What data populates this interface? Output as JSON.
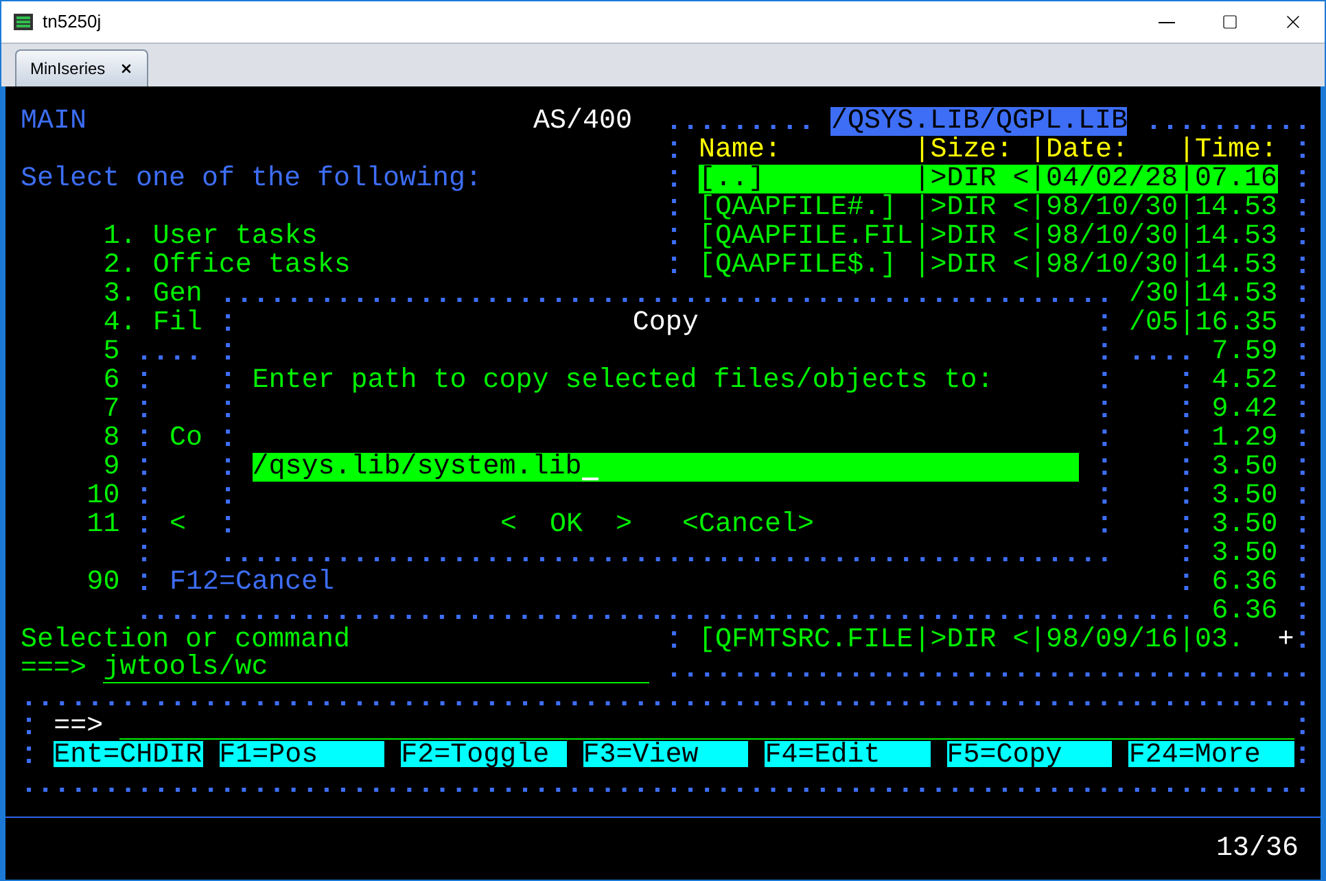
{
  "window": {
    "title": "tn5250j"
  },
  "tabs": [
    {
      "label": "MinIseries",
      "selected": true
    }
  ],
  "terminal": {
    "program": "MAIN",
    "system": "AS/400",
    "instruction": "Select one of the following:",
    "menu": [
      {
        "number": "1.",
        "label": "User tasks"
      },
      {
        "number": "2.",
        "label": "Office tasks"
      },
      {
        "number": "3.",
        "label": "Gen"
      },
      {
        "number": "4.",
        "label": "Fil"
      },
      {
        "number": "5"
      },
      {
        "number": "6"
      },
      {
        "number": "7"
      },
      {
        "number": "8"
      },
      {
        "number": "9"
      },
      {
        "number": "10"
      },
      {
        "number": "11"
      },
      {
        "number": "90"
      }
    ],
    "command": {
      "label": "Selection or command",
      "prompt": "===>",
      "value": "jwtools/wc"
    },
    "file_window": {
      "path": "/QSYS.LIB/QGPL.LIB",
      "columns": [
        "Name:",
        "|Size:",
        "|Date:",
        "|Time:"
      ],
      "rows": [
        {
          "kind": "entry",
          "selected": true,
          "name": "[..]",
          "size": "|>DIR <",
          "date": "|04/02/28",
          "time": "|07.16"
        },
        {
          "kind": "entry",
          "selected": false,
          "name": "[QAAPFILE#.]",
          "size": "|>DIR <",
          "date": "|98/10/30",
          "time": "|14.53"
        },
        {
          "kind": "entry",
          "selected": false,
          "name": "[QAAPFILE.FIL",
          "size": "|>DIR <",
          "date": "|98/10/30",
          "time": "|14.53"
        },
        {
          "kind": "entry",
          "selected": false,
          "name": "[QAAPFILE$.]",
          "size": "|>DIR <",
          "date": "|98/10/30",
          "time": "|14.53"
        },
        {
          "kind": "fragment",
          "selected": false,
          "date": "/30",
          "time": "|14.53"
        },
        {
          "kind": "fragment",
          "selected": false,
          "date": "/05",
          "time": "|16.35"
        },
        {
          "kind": "fragment",
          "selected": false,
          "time": "7.59"
        },
        {
          "kind": "fragment",
          "selected": false,
          "time": "4.52"
        },
        {
          "kind": "fragment",
          "selected": false,
          "time": "9.42"
        },
        {
          "kind": "fragment",
          "selected": false,
          "time": "1.29"
        },
        {
          "kind": "fragment",
          "selected": false,
          "time": "3.50"
        },
        {
          "kind": "fragment",
          "selected": false,
          "time": "3.50"
        },
        {
          "kind": "fragment",
          "selected": false,
          "time": "3.50"
        },
        {
          "kind": "fragment",
          "selected": false,
          "time": "3.50"
        },
        {
          "kind": "fragment",
          "selected": false,
          "time": "6.36"
        },
        {
          "kind": "fragment",
          "selected": false,
          "time": "6.36"
        },
        {
          "kind": "entry",
          "selected": false,
          "name": "[QFMTSRC.FILE",
          "size": "|>DIR <",
          "date": "|98/09/16",
          "time": "|03."
        }
      ],
      "more": "+"
    },
    "background_window": {
      "lines": [
        "Co",
        "<"
      ],
      "function_keys": "F12=Cancel"
    },
    "copy_dialog": {
      "title": "Copy",
      "message": "Enter path to copy selected files/objects to:",
      "path_field": {
        "value": "/qsys.lib/system.lib"
      },
      "buttons": [
        "<  OK  >",
        "<Cancel>"
      ]
    },
    "function_panel": {
      "prompt": "==>",
      "keys": [
        "Ent=CHDIR",
        "F1=Pos",
        "F2=Toggle",
        "F3=View",
        "F4=Edit",
        "F5=Copy",
        "F24=More"
      ]
    },
    "status": "13/36"
  }
}
